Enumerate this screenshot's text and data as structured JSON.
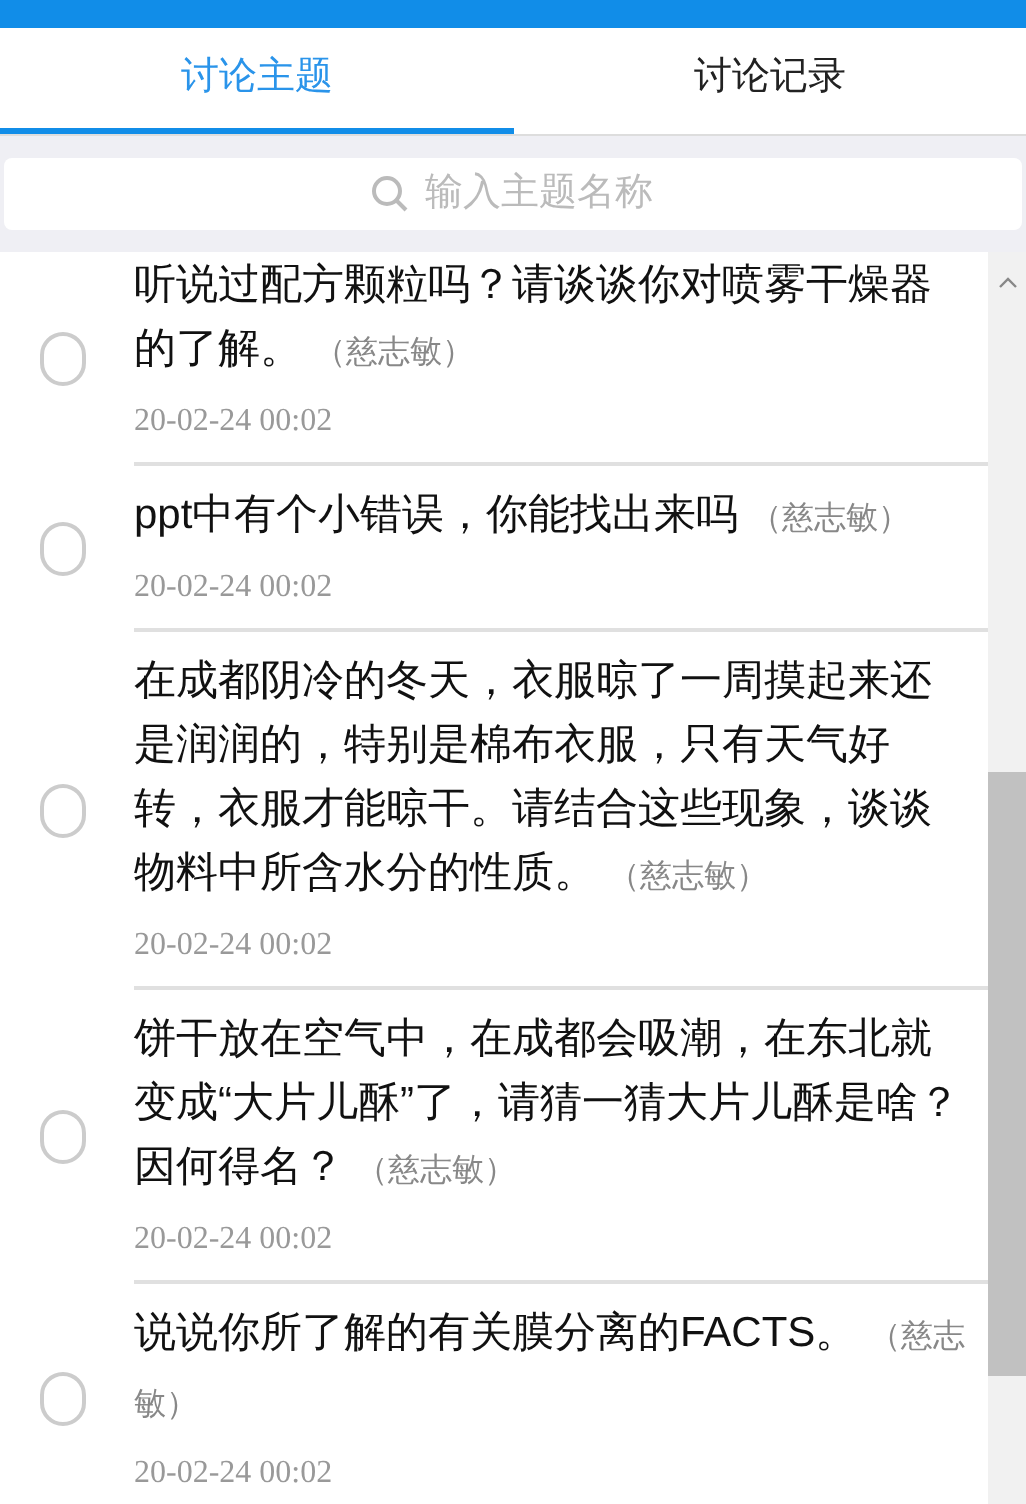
{
  "tabs": [
    {
      "label": "讨论主题",
      "selected": true
    },
    {
      "label": "讨论记录",
      "selected": false
    }
  ],
  "search": {
    "placeholder": "输入主题名称"
  },
  "topics": [
    {
      "title": "听说过配方颗粒吗？请谈谈你对喷雾干燥器的了解。",
      "author": "（慈志敏）",
      "time": "20-02-24 00:02",
      "selected": false
    },
    {
      "title": "ppt中有个小错误，你能找出来吗",
      "author": "（慈志敏）",
      "time": "20-02-24 00:02",
      "selected": false
    },
    {
      "title": "在成都阴冷的冬天，衣服晾了一周摸起来还是润润的，特别是棉布衣服，只有天气好转，衣服才能晾干。请结合这些现象，谈谈物料中所含水分的性质。",
      "author": "（慈志敏）",
      "time": "20-02-24 00:02",
      "selected": false
    },
    {
      "title": "饼干放在空气中，在成都会吸潮，在东北就变成“大片儿酥”了，请猜一猜大片儿酥是啥？因何得名？",
      "author": "（慈志敏）",
      "time": "20-02-24 00:02",
      "selected": false
    },
    {
      "title": "说说你所了解的有关膜分离的FACTS。",
      "author": "（慈志敏）",
      "time": "20-02-24 00:02",
      "selected": false
    }
  ]
}
